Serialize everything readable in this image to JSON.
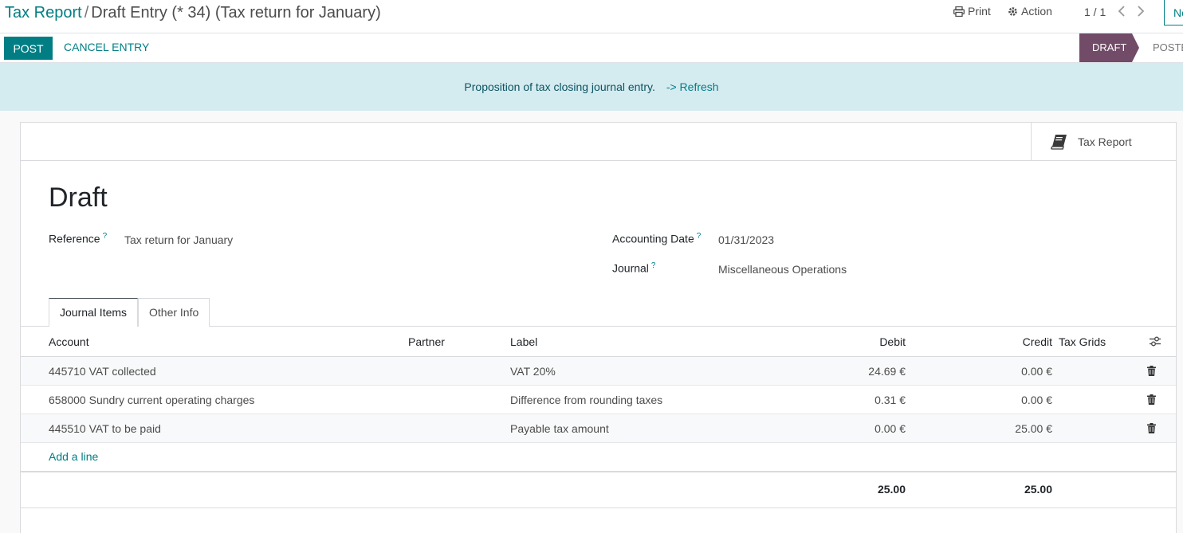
{
  "breadcrumb": {
    "parent": "Tax Report",
    "separator": "/",
    "current": "Draft Entry (* 34) (Tax return for January)"
  },
  "toolbar": {
    "print_label": "Print",
    "action_label": "Action",
    "pager": "1 / 1",
    "new_label": "Ne"
  },
  "statusbar": {
    "post_label": "POST",
    "cancel_label": "CANCEL ENTRY",
    "stages": [
      "DRAFT",
      "POSTE"
    ],
    "active_stage": "DRAFT"
  },
  "banner": {
    "message": "Proposition of tax closing journal entry.",
    "link": "-> Refresh"
  },
  "smart_button": {
    "label": "Tax Report",
    "icon": "book-icon"
  },
  "form": {
    "title": "Draft",
    "reference_label": "Reference",
    "reference_value": "Tax return for January",
    "accounting_date_label": "Accounting Date",
    "accounting_date_value": "01/31/2023",
    "journal_label": "Journal",
    "journal_value": "Miscellaneous Operations",
    "help_marker": "?"
  },
  "tabs": [
    "Journal Items",
    "Other Info"
  ],
  "table": {
    "columns": [
      "Account",
      "Partner",
      "Label",
      "Debit",
      "Credit",
      "Tax Grids"
    ],
    "rows": [
      {
        "account": "445710 VAT collected",
        "partner": "",
        "label": "VAT 20%",
        "debit": "24.69 €",
        "credit": "0.00 €",
        "tax_grids": ""
      },
      {
        "account": "658000 Sundry current operating charges",
        "partner": "",
        "label": "Difference from rounding taxes",
        "debit": "0.31 €",
        "credit": "0.00 €",
        "tax_grids": ""
      },
      {
        "account": "445510 VAT to be paid",
        "partner": "",
        "label": "Payable tax amount",
        "debit": "0.00 €",
        "credit": "25.00 €",
        "tax_grids": ""
      }
    ],
    "add_line_label": "Add a line",
    "total_debit": "25.00",
    "total_credit": "25.00"
  },
  "colors": {
    "primary": "#017e84",
    "stage_active": "#714b67",
    "banner_bg": "#d4ebf0"
  }
}
